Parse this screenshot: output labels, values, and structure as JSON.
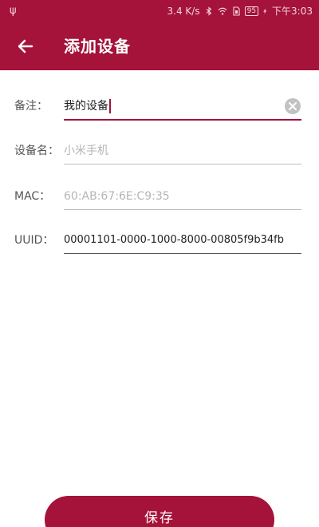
{
  "status_bar": {
    "network_speed": "3.4 K/s",
    "battery_level": "95",
    "time": "下午3:03",
    "icons": [
      "usb-icon",
      "bluetooth-icon",
      "wifi-icon",
      "sim-icon",
      "battery-icon",
      "charging-icon"
    ]
  },
  "app_bar": {
    "title": "添加设备",
    "back_icon": "arrow-left-icon"
  },
  "form": {
    "remark": {
      "label": "备注：",
      "value": "我的设备"
    },
    "device_name": {
      "label": "设备名：",
      "placeholder": "小米手机"
    },
    "mac": {
      "label": "MAC：",
      "placeholder": "60:AB:67:6E:C9:35"
    },
    "uuid": {
      "label": "UUID：",
      "value": "00001101-0000-1000-8000-00805f9b34fb"
    }
  },
  "actions": {
    "save_label": "保存"
  },
  "colors": {
    "primary": "#a5123a",
    "hint": "#b5b5b5"
  }
}
